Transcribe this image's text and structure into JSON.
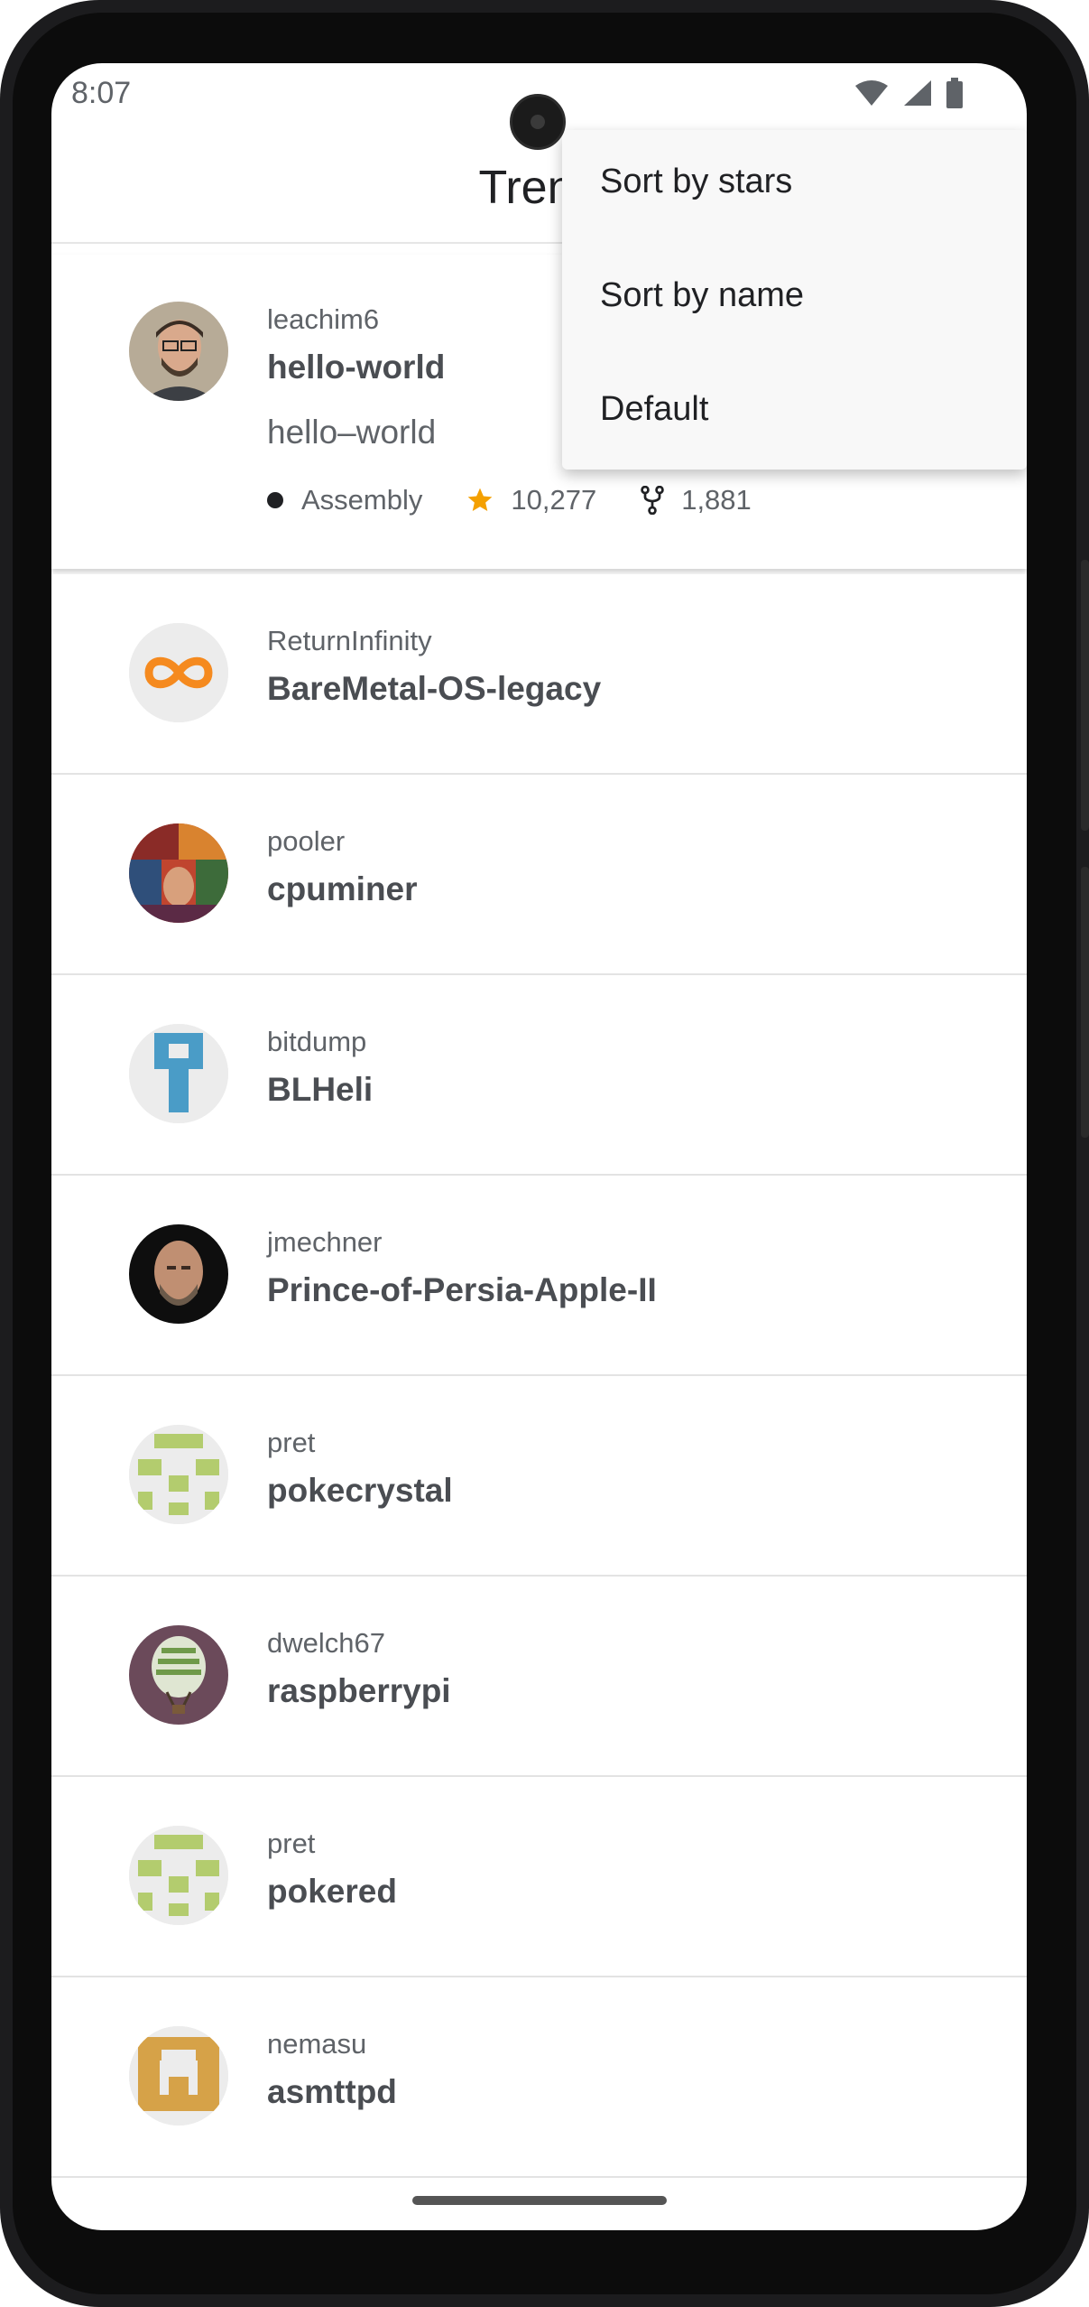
{
  "status_bar": {
    "time": "8:07"
  },
  "app_bar": {
    "title": "Trend"
  },
  "menu": {
    "items": [
      "Sort by stars",
      "Sort by name",
      "Default"
    ]
  },
  "expanded_repo": {
    "owner": "leachim6",
    "name": "hello-world",
    "description": "hello–world",
    "language": "Assembly",
    "stars": "10,277",
    "forks": "1,881",
    "star_color": "#f4a000"
  },
  "repos": [
    {
      "owner": "ReturnInfinity",
      "name": "BareMetal-OS-legacy",
      "avatar": "infinity-logo"
    },
    {
      "owner": "pooler",
      "name": "cpuminer",
      "avatar": "album-collage"
    },
    {
      "owner": "bitdump",
      "name": "BLHeli",
      "avatar": "blue-identicon"
    },
    {
      "owner": "jmechner",
      "name": "Prince-of-Persia-Apple-II",
      "avatar": "person-photo"
    },
    {
      "owner": "pret",
      "name": "pokecrystal",
      "avatar": "green-identicon"
    },
    {
      "owner": "dwelch67",
      "name": "raspberrypi",
      "avatar": "balloon-photo"
    },
    {
      "owner": "pret",
      "name": "pokered",
      "avatar": "green-identicon"
    },
    {
      "owner": "nemasu",
      "name": "asmttpd",
      "avatar": "orange-identicon"
    }
  ]
}
